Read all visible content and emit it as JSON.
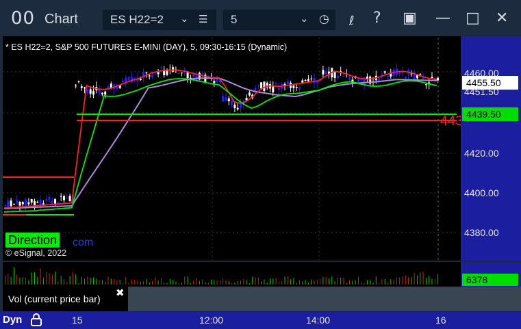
{
  "window": {
    "app_icon_text": "00",
    "title": "Chart",
    "symbol": "ES H22=2",
    "interval": "5"
  },
  "chart": {
    "header": "* ES H22=2, S&P 500 FUTURES E-MINI (DAY), 5, 09:30-16:15 (Dynamic)",
    "price_axis": [
      "4460.00",
      "4420.00",
      "4400.00",
      "4380.00"
    ],
    "partially_hidden_label": "4451.50",
    "last_price": "4455.50",
    "green_line_price": "4439.50",
    "red_overflow_text": "443",
    "direction_label": "Direction",
    "com_text": "com",
    "copyright": "© eSignal, 2022",
    "time_axis": [
      "15",
      "12:00",
      "14:00",
      "16"
    ],
    "dyn_label": "Dyn"
  },
  "volume": {
    "label": "Vol (current price bar)",
    "close": "✖",
    "value": "6378"
  },
  "colors": {
    "up": "#ffffff",
    "down": "#2222ff",
    "ma_red": "#ff2020",
    "ma_green": "#00ee00",
    "ma_purple": "#b08ad8",
    "axis_bg": "#1c1ea0"
  },
  "chart_data": {
    "type": "candlestick",
    "y_range": [
      4370,
      4480
    ],
    "levels": [
      {
        "price": 4439.5,
        "color": "green"
      },
      {
        "price": 4436,
        "color": "red"
      }
    ]
  }
}
